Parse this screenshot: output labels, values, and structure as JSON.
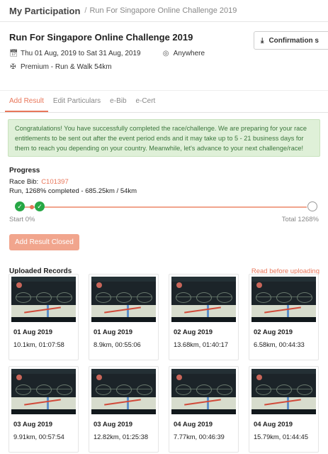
{
  "breadcrumb": {
    "section": "My Participation",
    "separator": "/",
    "page": "Run For Singapore Online Challenge 2019"
  },
  "event": {
    "title": "Run For Singapore Online Challenge 2019",
    "dates": "Thu 01 Aug, 2019 to Sat 31 Aug, 2019",
    "location": "Anywhere",
    "category": "Premium - Run & Walk 54km",
    "confirmation_label": "Confirmation s"
  },
  "tabs": [
    {
      "label": "Add Result",
      "active": true
    },
    {
      "label": "Edit Particulars",
      "active": false
    },
    {
      "label": "e-Bib",
      "active": false
    },
    {
      "label": "e-Cert",
      "active": false
    }
  ],
  "alert": {
    "text": "Congratulations! You have successfully completed the race/challenge. We are preparing for your race entitlements to be sent out after the event period ends and it may take up to 5 - 21 business days for them to reach you depending on your country. Meanwhile, let's advance to your next challenge/race!"
  },
  "progress": {
    "heading": "Progress",
    "bib_label": "Race Bib:",
    "bib_value": "C101397",
    "summary": "Run, 1268% completed - 685.25km / 54km",
    "start_label": "Start 0%",
    "total_label": "Total 1268%",
    "add_result_button": "Add Result Closed"
  },
  "records": {
    "heading": "Uploaded Records",
    "link": "Read before uploading",
    "items": [
      {
        "date": "01 Aug 2019",
        "stats": "10.1km, 01:07:58"
      },
      {
        "date": "01 Aug 2019",
        "stats": "8.9km, 00:55:06"
      },
      {
        "date": "02 Aug 2019",
        "stats": "13.68km, 01:40:17"
      },
      {
        "date": "02 Aug 2019",
        "stats": "6.58km, 00:44:33"
      },
      {
        "date": "03 Aug 2019",
        "stats": "9.91km, 00:57:54"
      },
      {
        "date": "03 Aug 2019",
        "stats": "12.82km, 01:25:38"
      },
      {
        "date": "04 Aug 2019",
        "stats": "7.77km, 00:46:39"
      },
      {
        "date": "04 Aug 2019",
        "stats": "15.79km, 01:44:45"
      }
    ]
  },
  "colors": {
    "accent": "#e8765a",
    "success": "#27a745",
    "alert_bg": "#dff0d8",
    "alert_text": "#3c763d"
  },
  "icons": [
    "calendar-icon",
    "location-pin-icon",
    "runner-icon",
    "download-icon",
    "check-icon"
  ]
}
